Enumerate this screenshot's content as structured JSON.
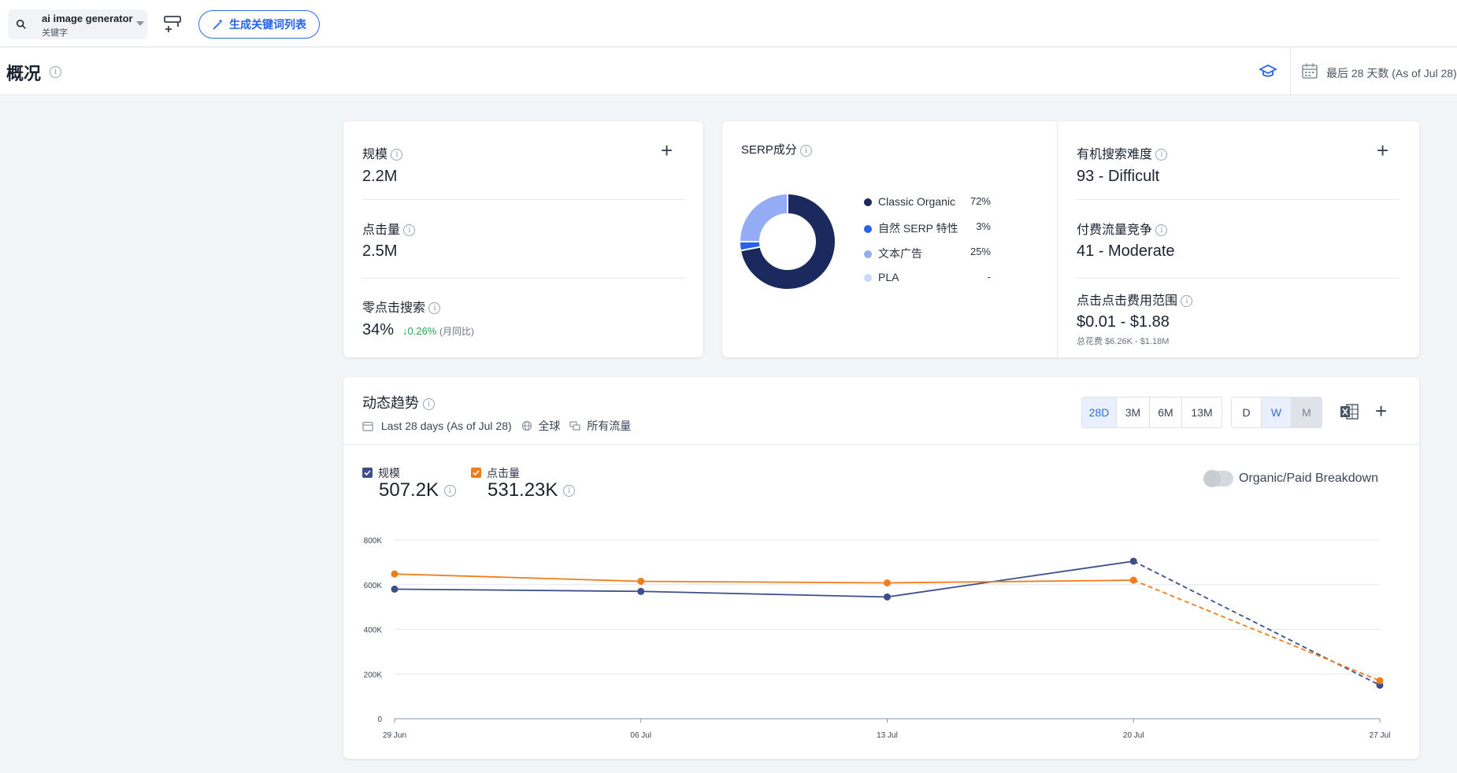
{
  "topbar": {
    "keyword": "ai image generator",
    "keyword_type": "关键字",
    "generate_label": "生成关键词列表"
  },
  "header": {
    "title": "概况",
    "date_range": "最后 28 天数 (As of Jul 28)"
  },
  "metrics": {
    "volume": {
      "label": "规模",
      "value": "2.2M"
    },
    "clicks": {
      "label": "点击量",
      "value": "2.5M"
    },
    "zero_click": {
      "label": "零点击搜索",
      "value": "34%",
      "delta": "↓0.26%",
      "delta_note": "(月同比)"
    }
  },
  "serp": {
    "title": "SERP成分",
    "items": [
      {
        "label": "Classic Organic",
        "value": "72%",
        "color": "#1b2a5e"
      },
      {
        "label": "自然 SERP 特性",
        "value": "3%",
        "color": "#2563eb"
      },
      {
        "label": "文本广告",
        "value": "25%",
        "color": "#93acf5"
      },
      {
        "label": "PLA",
        "value": "-",
        "color": "#c9d7f8"
      }
    ]
  },
  "difficulty": {
    "organic": {
      "label": "有机搜索难度",
      "value": "93 - Difficult"
    },
    "paid": {
      "label": "付费流量竞争",
      "value": "41 - Moderate"
    },
    "cpc": {
      "label": "点击点击费用范围",
      "value": "$0.01 - $1.88",
      "sub": "总花费 $6.26K - $1.18M"
    }
  },
  "trend": {
    "title": "动态趋势",
    "period": "Last 28 days (As of Jul 28)",
    "region": "全球",
    "traffic": "所有流量",
    "range_tabs": [
      "28D",
      "3M",
      "6M",
      "13M"
    ],
    "granularity_tabs": [
      "D",
      "W",
      "M"
    ],
    "series_labels": {
      "volume": "规模",
      "clicks": "点击量"
    },
    "series_values": {
      "volume": "507.2K",
      "clicks": "531.23K"
    },
    "breakdown_label": "Organic/Paid Breakdown"
  },
  "colors": {
    "volume": "#3d4f8a",
    "clicks": "#f07d1a",
    "accent": "#2563eb"
  },
  "chart_data": {
    "type": "line",
    "x": [
      "29 Jun",
      "06 Jul",
      "13 Jul",
      "20 Jul",
      "27 Jul"
    ],
    "series": [
      {
        "name": "规模",
        "values": [
          580000,
          570000,
          545000,
          705000,
          150000
        ]
      },
      {
        "name": "点击量",
        "values": [
          648000,
          615000,
          608000,
          620000,
          170000
        ]
      }
    ],
    "yticks": [
      "0",
      "200K",
      "400K",
      "600K",
      "800K"
    ],
    "ylim": [
      0,
      800000
    ],
    "grid": true,
    "dashed_last_segment": true
  }
}
